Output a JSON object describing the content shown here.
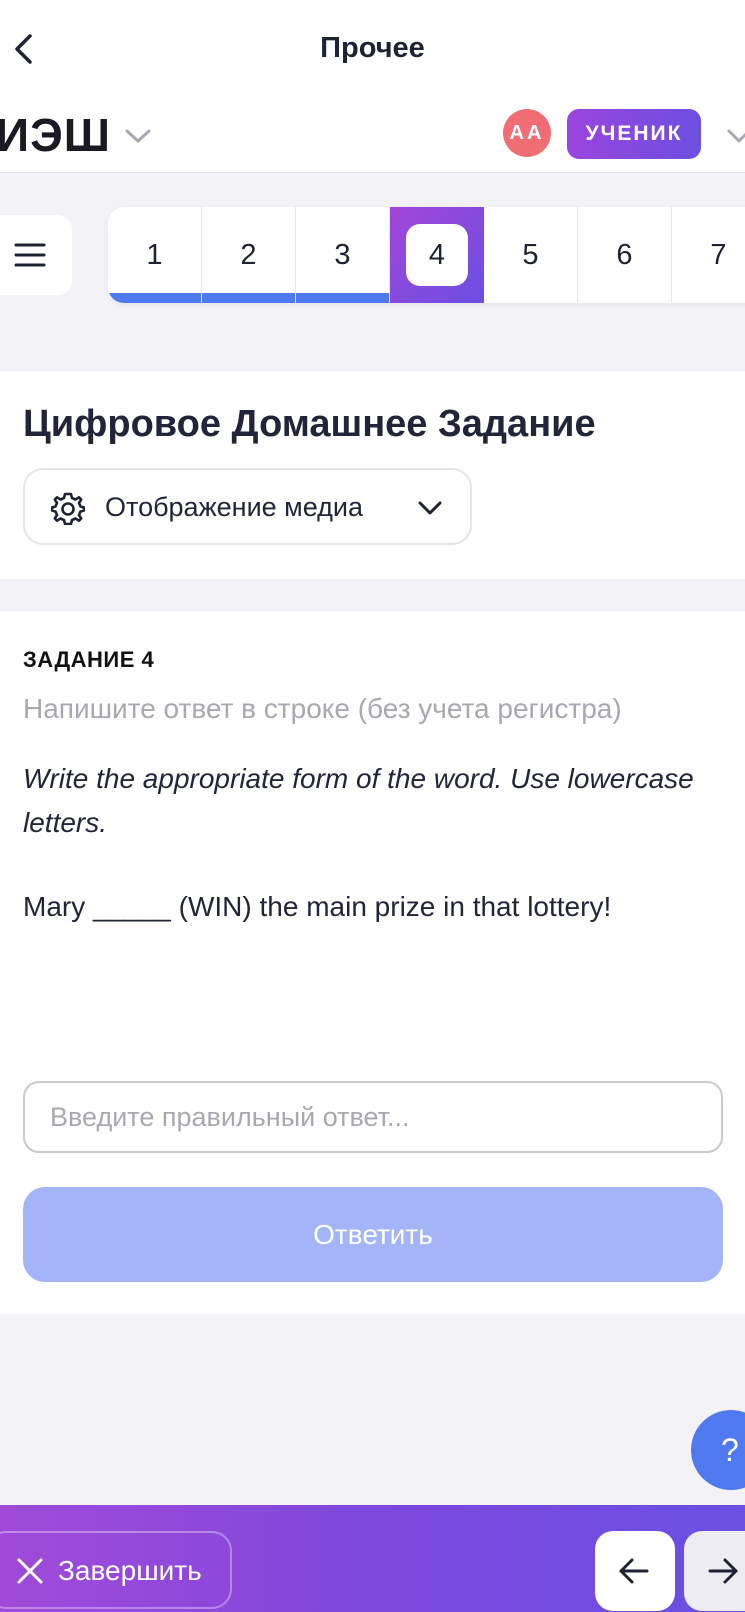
{
  "nav": {
    "title": "Прочее"
  },
  "header": {
    "logo": "ИЭШ",
    "avatar_initials": "АА",
    "role": "УЧЕНИК"
  },
  "tasks": [
    {
      "label": "1",
      "completed": true,
      "active": false
    },
    {
      "label": "2",
      "completed": true,
      "active": false
    },
    {
      "label": "3",
      "completed": true,
      "active": false
    },
    {
      "label": "4",
      "completed": false,
      "active": true
    },
    {
      "label": "5",
      "completed": false,
      "active": false
    },
    {
      "label": "6",
      "completed": false,
      "active": false
    },
    {
      "label": "7",
      "completed": false,
      "active": false
    }
  ],
  "page": {
    "title": "Цифровое Домашнее Задание",
    "media_button": "Отображение медиа"
  },
  "task": {
    "label": "ЗАДАНИЕ 4",
    "hint": "Напишите ответ в строке (без учета регистра)",
    "instruction": "Write the appropriate form of the word. Use lowercase letters.",
    "sentence": "Mary _____ (WIN) the main prize in that lottery!",
    "input_placeholder": "Введите правильный ответ...",
    "input_value": "",
    "submit_label": "Ответить"
  },
  "help": {
    "label": "?"
  },
  "footer": {
    "finish_label": "Завершить"
  },
  "colors": {
    "accent_blue": "#4f79ee",
    "accent_purple": "#8a4bdc",
    "avatar": "#f06e73",
    "submit_disabled": "#a3b5f8"
  }
}
